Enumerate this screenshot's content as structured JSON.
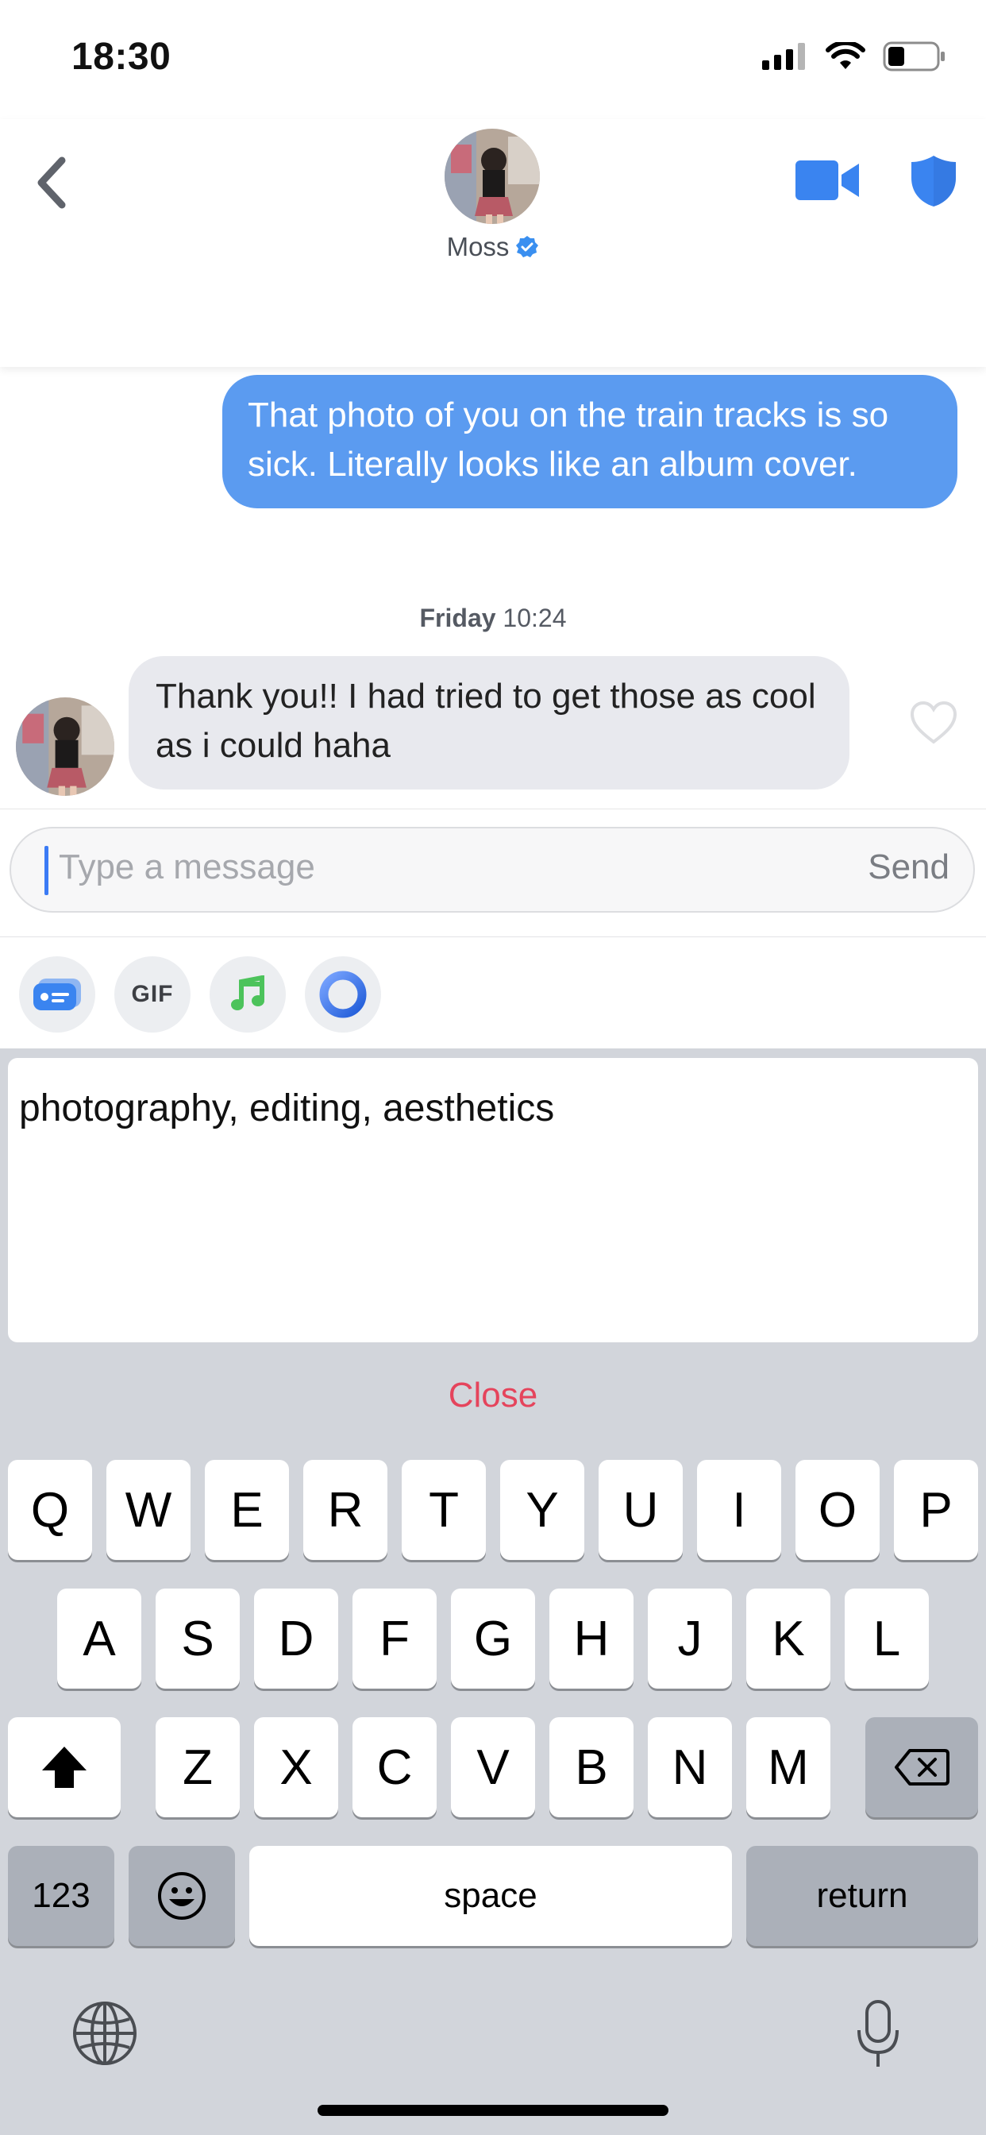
{
  "status_bar": {
    "time": "18:30",
    "battery_level": 0.35
  },
  "header": {
    "contact_name": "Moss",
    "verified": true
  },
  "messages": [
    {
      "direction": "outgoing",
      "text": "That photo of you on the train tracks is so sick. Literally looks like an album cover."
    },
    {
      "type": "timestamp",
      "day": "Friday",
      "time": "10:24"
    },
    {
      "direction": "incoming",
      "text": "Thank you!! I had tried to get those as cool as i could haha"
    }
  ],
  "composer": {
    "placeholder": "Type a message",
    "send_label": "Send"
  },
  "toolbar": {
    "gif_label": "GIF"
  },
  "suggestion": {
    "text": "photography, editing, aesthetics",
    "close_label": "Close"
  },
  "keyboard": {
    "row1": [
      "Q",
      "W",
      "E",
      "R",
      "T",
      "Y",
      "U",
      "I",
      "O",
      "P"
    ],
    "row2": [
      "A",
      "S",
      "D",
      "F",
      "G",
      "H",
      "J",
      "K",
      "L"
    ],
    "row3": [
      "Z",
      "X",
      "C",
      "V",
      "B",
      "N",
      "M"
    ],
    "numbers_label": "123",
    "space_label": "space",
    "return_label": "return"
  },
  "colors": {
    "outgoing_bubble": "#5b9bf0",
    "incoming_bubble": "#e8e9ee",
    "accent_blue": "#3b7bf5",
    "close_red": "#e5445c",
    "keyboard_bg": "#d2d5db"
  },
  "icons": [
    "back-chevron-icon",
    "verified-badge-icon",
    "video-camera-icon",
    "shield-icon",
    "heart-icon",
    "message-card-icon",
    "music-note-icon",
    "ring-icon",
    "shift-icon",
    "backspace-icon",
    "emoji-icon",
    "globe-icon",
    "microphone-icon"
  ]
}
